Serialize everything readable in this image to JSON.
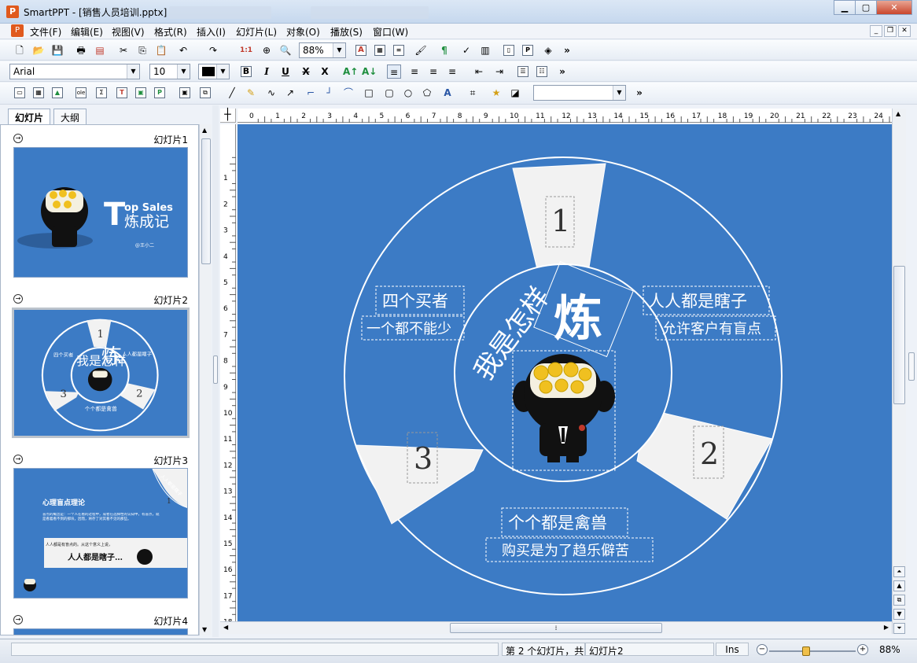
{
  "window": {
    "title": "SmartPPT - [销售人员培训.pptx]",
    "app_icon": "P"
  },
  "menu": [
    "文件(F)",
    "编辑(E)",
    "视图(V)",
    "格式(R)",
    "插入(I)",
    "幻灯片(L)",
    "对象(O)",
    "播放(S)",
    "窗口(W)"
  ],
  "toolbar": {
    "zoom": "88%",
    "font": "Arial",
    "font_size": "10",
    "more": "»"
  },
  "side_tabs": [
    "幻灯片",
    "大纲"
  ],
  "thumbnails": [
    {
      "label": "幻灯片1",
      "title_line1": "op  Sales",
      "title_big_letter": "T",
      "title_line2": "炼成记",
      "author": "@王小二"
    },
    {
      "label": "幻灯片2"
    },
    {
      "label": "幻灯片3",
      "heading": "心理盲点理论",
      "body": "盲点的概念是：一个人在看的过程中，或者在选择性的认知中，有盲点，就是看着看不到的那块，因而，将存了对其看不见的那些。",
      "quote": "人人都是有盲点的。从这个意义上说，",
      "big_text": "人人都是瞎子…",
      "badge_text": "人人都是瞎子",
      "badge_num": "1"
    },
    {
      "label": "幻灯片4"
    }
  ],
  "slide": {
    "center_text": "我是怎样",
    "center_big": "炼",
    "seg1_num": "1",
    "seg2_num": "2",
    "seg3_num": "3",
    "topic_left_title": "四个买者",
    "topic_left_sub": "一个都不能少",
    "topic_right_title": "人人都是瞎子",
    "topic_right_sub": "允许客户有盲点",
    "topic_bottom_title": "个个都是禽兽",
    "topic_bottom_sub": "购买是为了趋乐僻苦",
    "bg_color": "#3c7bc5"
  },
  "status": {
    "slide_info": "第 2 个幻灯片，共",
    "slide_name": "幻灯片2",
    "mode": "Ins",
    "zoom": "88%"
  }
}
